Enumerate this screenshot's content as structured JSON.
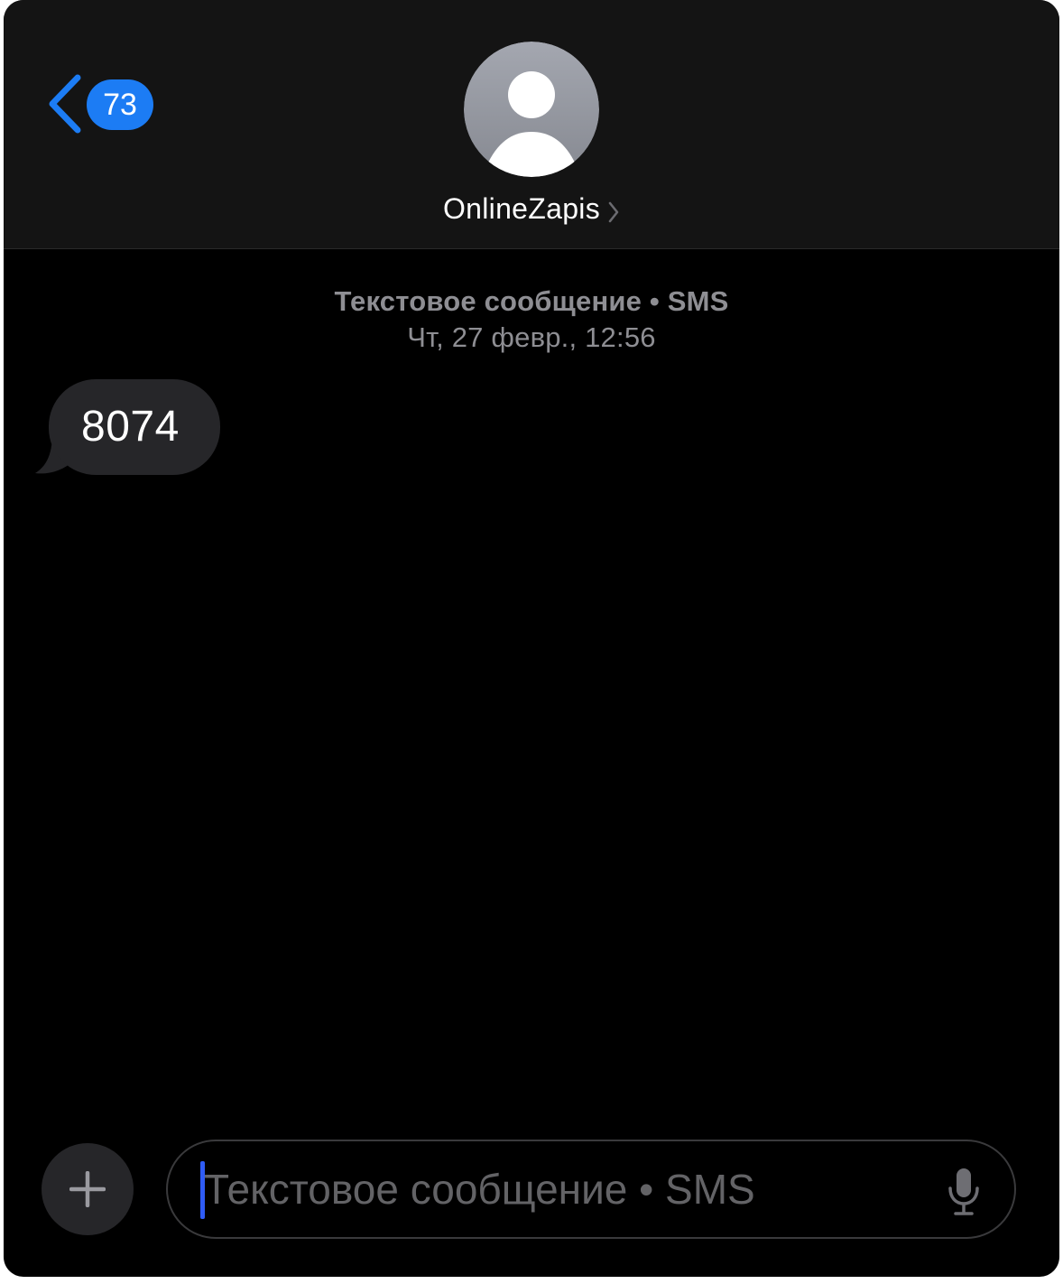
{
  "header": {
    "unread_count": "73",
    "contact_name": "OnlineZapis"
  },
  "thread": {
    "service_label": "Текстовое сообщение • SMS",
    "timestamp": "Чт, 27 февр., 12:56",
    "messages": [
      {
        "direction": "incoming",
        "text": "8074"
      }
    ]
  },
  "composer": {
    "placeholder": "Текстовое сообщение • SMS",
    "value": ""
  },
  "icons": {
    "back": "chevron-left-icon",
    "avatar": "person-silhouette-icon",
    "contact_details": "chevron-right-icon",
    "add": "plus-icon",
    "dictation": "microphone-icon"
  },
  "colors": {
    "accent": "#1c7cf4",
    "incoming_bubble": "#262629",
    "header_bg": "#141414",
    "caret": "#2f5cf5"
  }
}
